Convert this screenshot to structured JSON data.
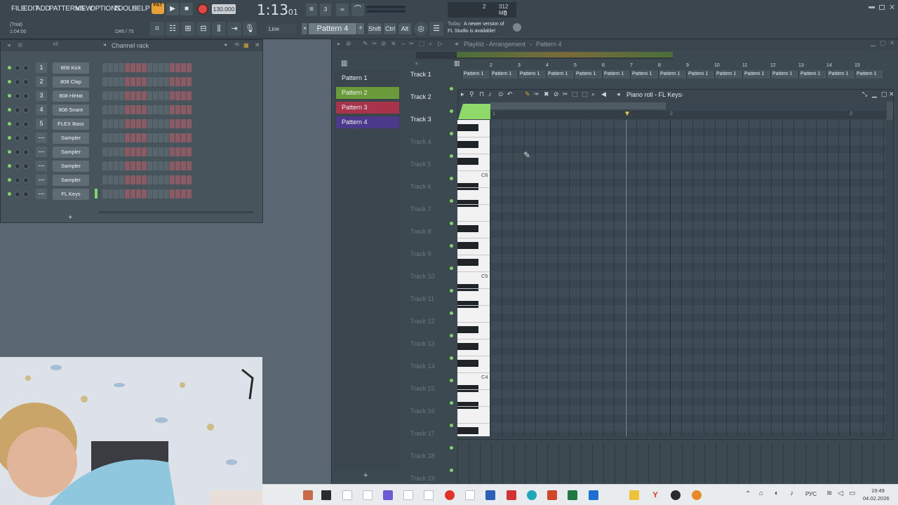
{
  "menu": {
    "file": "FILE",
    "edit": "EDIT",
    "add": "ADD",
    "patterns": "PATTERNS",
    "view": "VIEW",
    "options": "OPTIONS",
    "tools": "TOOLS",
    "help": "HELP"
  },
  "toolbar": {
    "pat_label": "PAT",
    "tempo": "130.000",
    "time_main": "1:13",
    "time_sub": "01",
    "trial": "(Trial)",
    "hint_pos": "1:04:00",
    "hint_note": "D#6 / 75",
    "line_mode": "Line",
    "pattern": "Pattern 4",
    "shift": "Shift",
    "ctrl": "Ctrl",
    "alt": "Alt",
    "cpu_num": "2",
    "mem": "312 MB",
    "poly": "0",
    "news_today": "Today",
    "news_text1": "A newer version of",
    "news_text2": "FL Studio is available!"
  },
  "rack": {
    "title": "Channel rack",
    "filter": "All",
    "add": "+",
    "channels": [
      {
        "num": "1",
        "name": "808 Kick"
      },
      {
        "num": "2",
        "name": "808 Clap"
      },
      {
        "num": "3",
        "name": "808 HiHat"
      },
      {
        "num": "4",
        "name": "808 Snare"
      },
      {
        "num": "5",
        "name": "FLEX Bass"
      },
      {
        "num": "---",
        "name": "Sampler"
      },
      {
        "num": "---",
        "name": "Sampler"
      },
      {
        "num": "---",
        "name": "Sampler"
      },
      {
        "num": "---",
        "name": "Sampler"
      },
      {
        "num": "---",
        "name": "FL Keys"
      }
    ]
  },
  "playlist": {
    "title": "Playlist - Arrangement",
    "crumb": "Pattern 4",
    "patterns": [
      {
        "name": "Pattern 1",
        "color": "#3a454d"
      },
      {
        "name": "Pattern 2",
        "color": "#6a9a3a"
      },
      {
        "name": "Pattern 3",
        "color": "#a8344c"
      },
      {
        "name": "Pattern 4",
        "color": "#4b3a8a"
      }
    ],
    "tracks": [
      "Track 1",
      "Track 2",
      "Track 3",
      "Track 4",
      "Track 5",
      "Track 6",
      "Track 7",
      "Track 8",
      "Track 9",
      "Track 10",
      "Track 11",
      "Track 12",
      "Track 13",
      "Track 14",
      "Track 15",
      "Track 16",
      "Track 17",
      "Track 18",
      "Track 19"
    ],
    "clip": "Pattern 1",
    "ruler": [
      "2",
      "3",
      "4",
      "5",
      "6",
      "7",
      "8",
      "9",
      "10",
      "11",
      "12",
      "13",
      "14",
      "15"
    ],
    "add": "+"
  },
  "pianoroll": {
    "title": "Piano roll - FL Keys",
    "labels": {
      "c6": "C6",
      "c5": "C5",
      "c4": "C4"
    },
    "ruler": [
      "2",
      "3"
    ]
  },
  "taskbar": {
    "lang": "РУС",
    "time": "19:49",
    "date": "04.02.2026"
  },
  "colors": {
    "accent_green": "#8fd96b",
    "pattern2": "#6a9a3a",
    "pattern3": "#a8344c",
    "pattern4": "#4b3a8a"
  }
}
